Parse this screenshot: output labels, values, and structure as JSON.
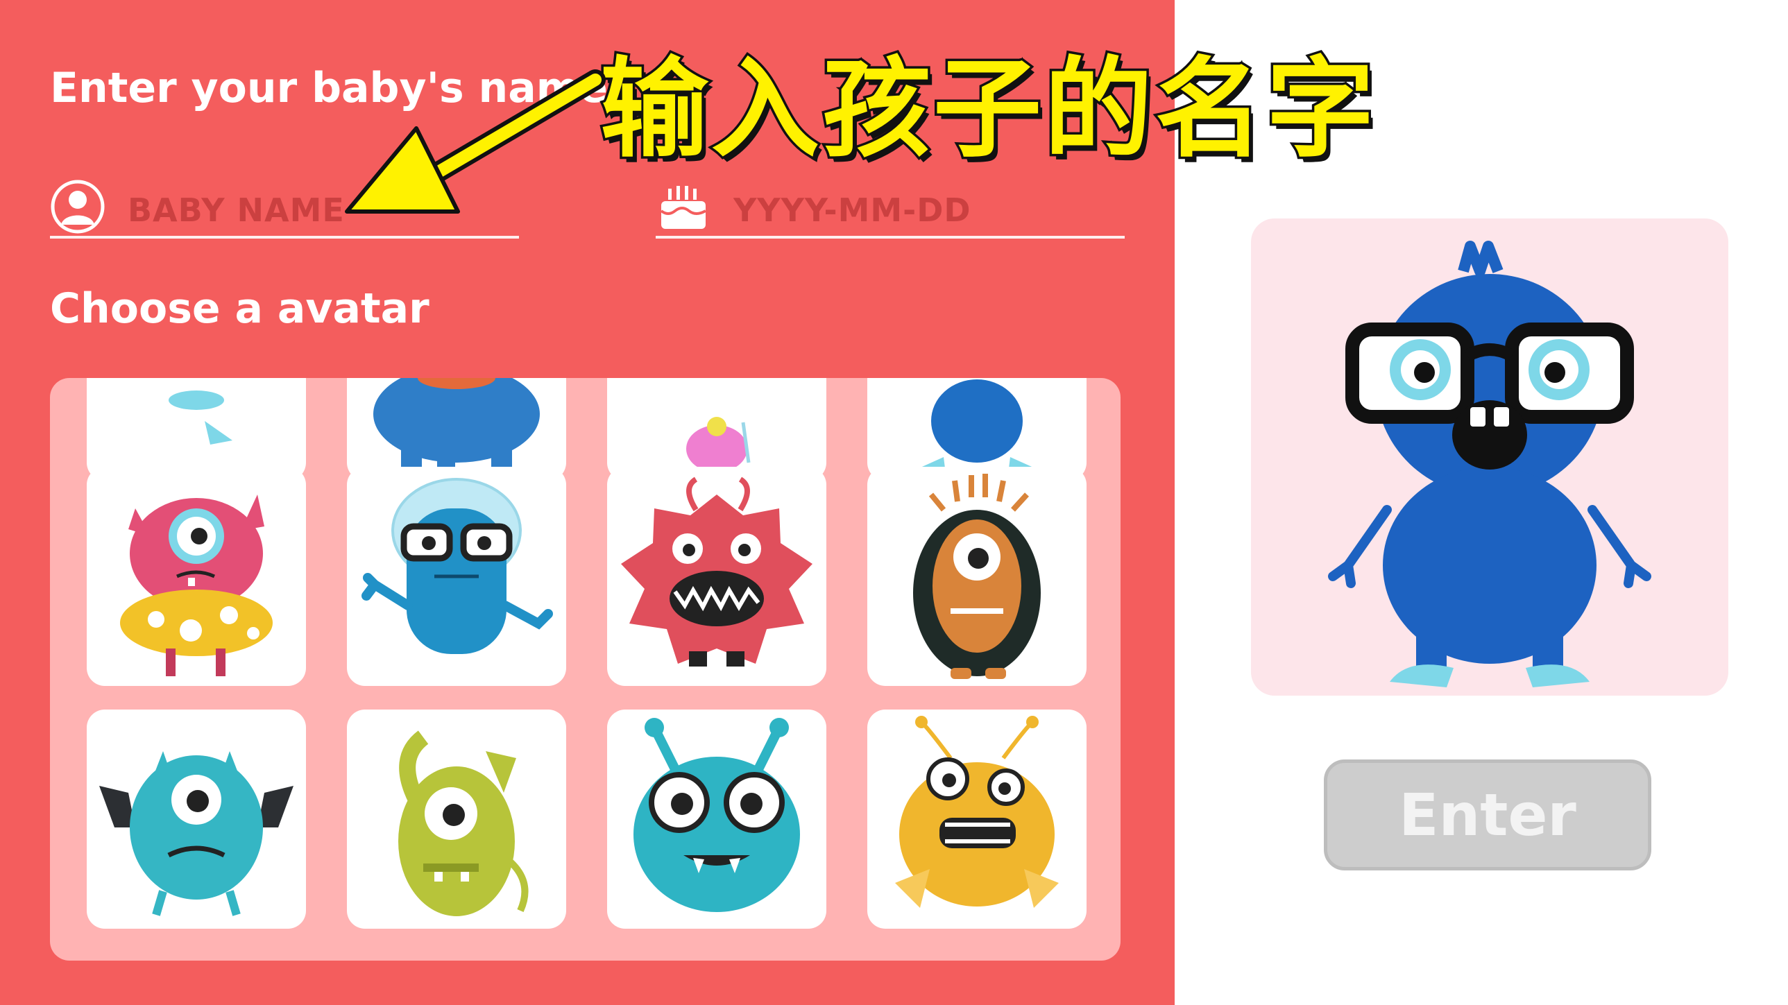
{
  "form": {
    "name_heading": "Enter your baby's name",
    "name_placeholder": "BABY NAME",
    "name_value": "",
    "birthday_placeholder": "YYYY-MM-DD",
    "birthday_value": "",
    "avatar_heading": "Choose a avatar"
  },
  "avatars": [
    {
      "name": "blue-legs-monster",
      "color": "#7ed7e8"
    },
    {
      "name": "blue-big-monster",
      "color": "#2f7ec8"
    },
    {
      "name": "pink-small-monster",
      "color": "#ef7fd0"
    },
    {
      "name": "blue-round-monster",
      "color": "#1f6fc4"
    },
    {
      "name": "pink-cyclops-monster",
      "color": "#e34f76"
    },
    {
      "name": "blue-astronaut-monster",
      "color": "#2191c7"
    },
    {
      "name": "red-spiky-monster",
      "color": "#e04f5c"
    },
    {
      "name": "orange-egg-monster",
      "color": "#d9843a"
    },
    {
      "name": "teal-winged-monster",
      "color": "#35b6c4"
    },
    {
      "name": "green-horned-monster",
      "color": "#b7c43a"
    },
    {
      "name": "teal-antenna-monster",
      "color": "#2eb4c4"
    },
    {
      "name": "yellow-furry-monster",
      "color": "#f0b62d"
    }
  ],
  "preview": {
    "avatar": "blue-nerd-monster",
    "color": "#1d62c1"
  },
  "enter_button": "Enter",
  "annotation": "输入孩子的名字",
  "colors": {
    "panel": "#f45d5d",
    "grid": "#ffb3b3",
    "preview_bg": "#fde5ea",
    "button": "#cdcdcd",
    "annotation": "#fff200"
  }
}
